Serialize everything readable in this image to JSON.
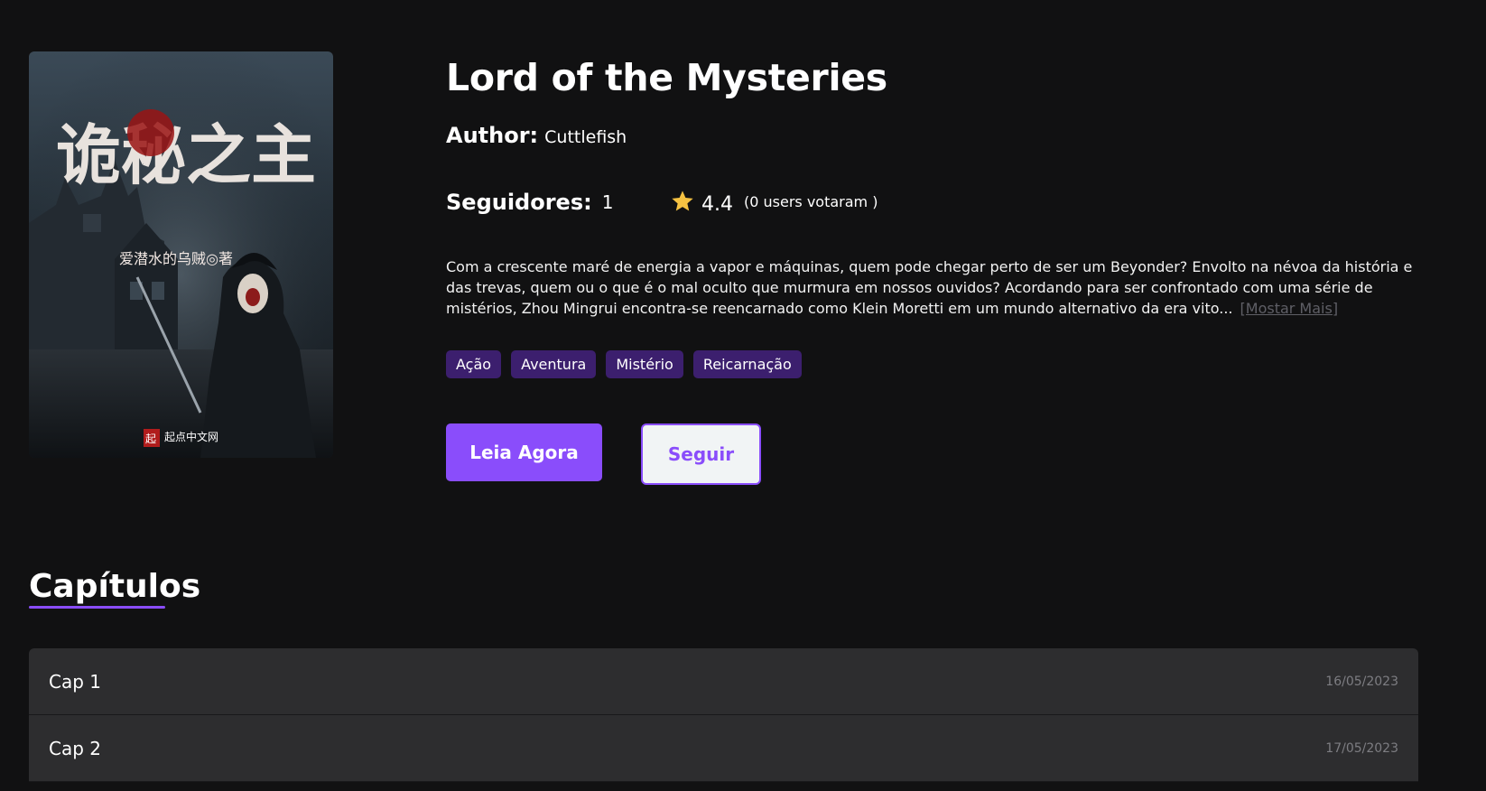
{
  "novel": {
    "title": "Lord of the Mysteries",
    "author_label": "Author:",
    "author_name": "Cuttlefish",
    "followers_label": "Seguidores:",
    "followers_count": "1",
    "rating": "4.4",
    "votes_text": "(0 users votaram )",
    "synopsis": "Com a crescente maré de energia a vapor e máquinas, quem pode chegar perto de ser um Beyonder? Envolto na névoa da história e das trevas, quem ou o que é o mal oculto que murmura em nossos ouvidos? Acordando para ser confrontado com uma série de mistérios, Zhou Mingrui encontra-se reencarnado como Klein Moretti em um mundo alternativo da era vito...",
    "more_link": "[Mostar Mais]",
    "tags": [
      "Ação",
      "Aventura",
      "Mistério",
      "Reicarnação"
    ],
    "cover_text": {
      "calligraphy": "诡秘之主",
      "byline": "爱潜水的乌贼◎著",
      "publisher": "起点中文网",
      "publisher_seal": "起"
    }
  },
  "actions": {
    "read_label": "Leia Agora",
    "follow_label": "Seguir"
  },
  "chapters": {
    "heading": "Capítulos",
    "items": [
      {
        "name": "Cap 1",
        "date": "16/05/2023"
      },
      {
        "name": "Cap 2",
        "date": "17/05/2023"
      }
    ]
  },
  "colors": {
    "background": "#111112",
    "accent": "#8a4dfb",
    "tag_bg": "#3c1f6e",
    "star": "#f5c242",
    "row_bg": "#2d2d2f"
  },
  "icons": {
    "rating": "star-icon"
  }
}
